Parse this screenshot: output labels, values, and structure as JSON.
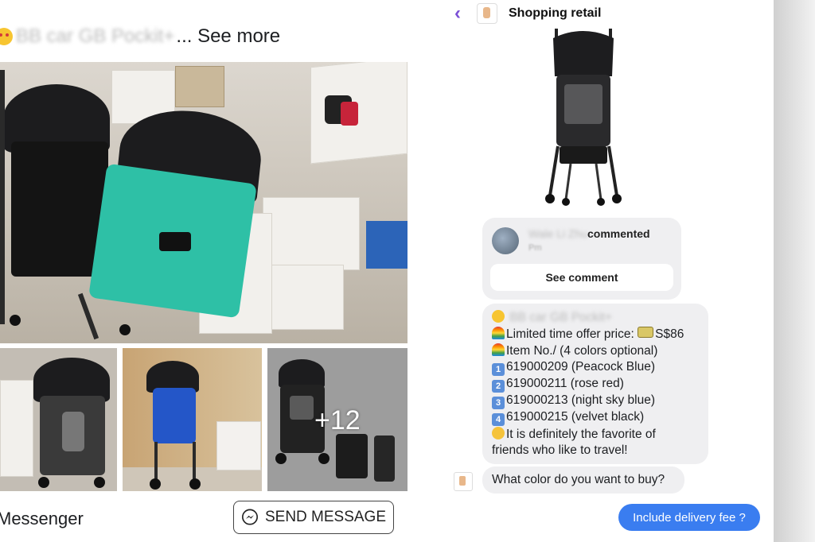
{
  "post": {
    "header_blurred": "BB car GB Pockit+",
    "see_more": "... See more",
    "more_photos_count": "+12",
    "messenger_label": "Messenger",
    "send_message_label": "SEND MESSAGE"
  },
  "chat": {
    "title": "Shopping retail",
    "comment": {
      "name_blurred": "Wale Li Zhu",
      "action": "commented",
      "time_blurred": "Pm",
      "button": "See comment"
    },
    "offer_lines": {
      "l0": "BB car GB Pockit+",
      "l1": "Limited time offer price:",
      "l1_price": "S$86",
      "l2": "Item No./ (4 colors optional)",
      "l3": "619000209 (Peacock Blue)",
      "l4": "619000211 (rose red)",
      "l5": "619000213 (night sky blue)",
      "l6": "619000215 (velvet black)",
      "l7": "It is definitely the favorite of",
      "l8": "friends who like to travel!"
    },
    "number_badges": [
      "1",
      "2",
      "3",
      "4"
    ],
    "question": "What color do you want to buy?",
    "sent_reply": "Include delivery fee ?"
  },
  "colors": {
    "messenger_accent": "#7b4fd6",
    "sent_bubble": "#3a7df0",
    "bubble_grey": "#efeff1",
    "teal_seat": "#2ec0a6"
  }
}
